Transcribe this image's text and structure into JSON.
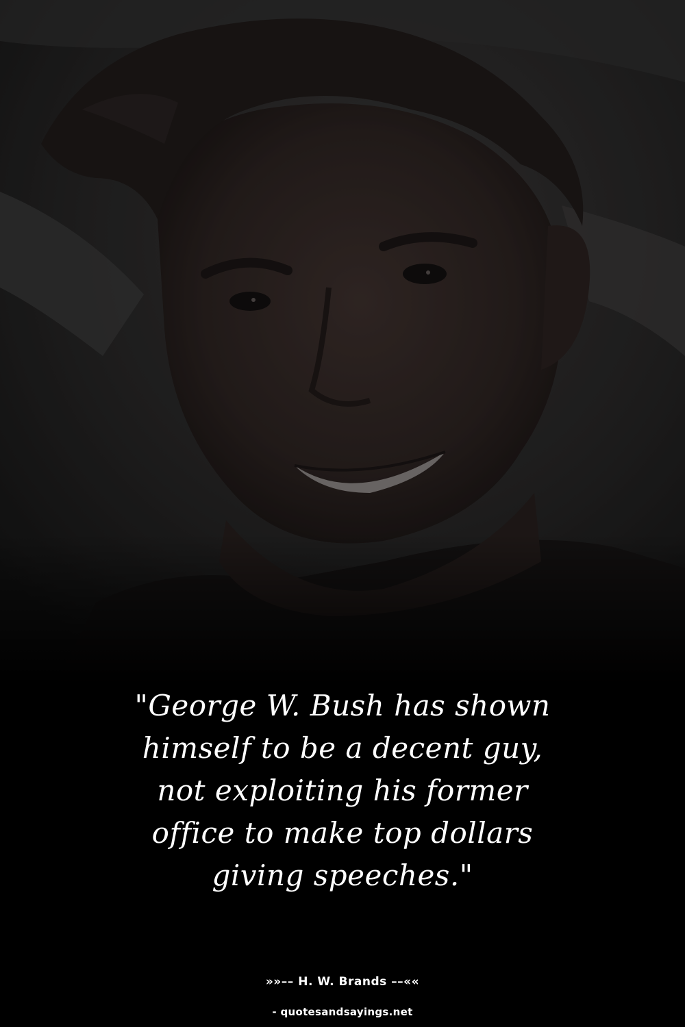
{
  "photo": {
    "subject": "smiling-man-portrait"
  },
  "quote": {
    "lines": [
      "\"George W. Bush has shown",
      "himself to be a decent guy,",
      "not exploiting his former",
      "office to make top dollars",
      "giving speeches.\""
    ]
  },
  "attribution": {
    "author_line": "»»–– H. W. Brands ––««"
  },
  "footer": {
    "source": "- quotesandsayings.net"
  },
  "colors": {
    "background": "#000000",
    "text": "#ffffff"
  }
}
